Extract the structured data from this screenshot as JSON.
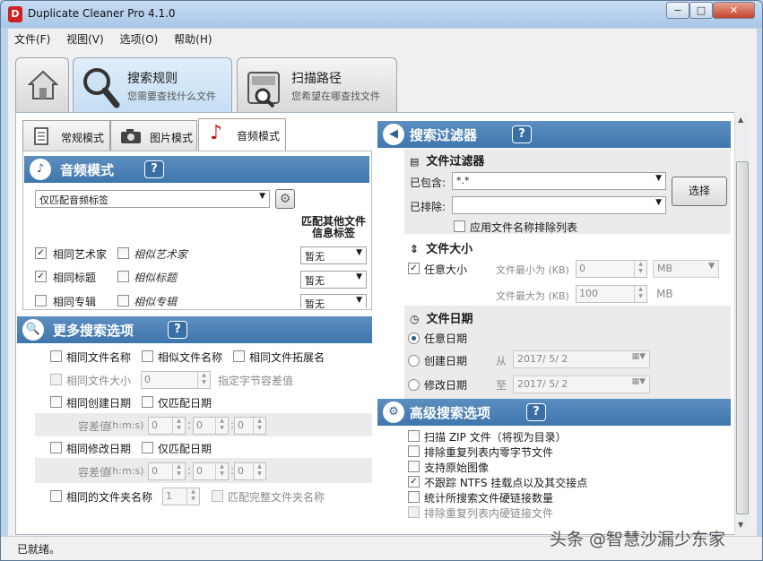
{
  "window": {
    "title": "Duplicate Cleaner Pro 4.1.0",
    "app_icon_letter": "D",
    "min": "−",
    "max": "□",
    "close": "✕"
  },
  "menu": [
    "文件(F)",
    "视图(V)",
    "选项(O)",
    "帮助(H)"
  ],
  "big_tabs": [
    {
      "title": "搜索规则",
      "subtitle": "您需要查找什么文件"
    },
    {
      "title": "扫描路径",
      "subtitle": "您希望在哪查找文件"
    }
  ],
  "mode_tabs": [
    "常规模式",
    "图片模式",
    "音频模式"
  ],
  "audio": {
    "header": "音频模式",
    "help": "?",
    "match_select": "仅匹配音频标签",
    "match_other_label": "匹配其他文件信息标签",
    "rows": [
      {
        "checked": true,
        "label": "相同艺术家",
        "similar": "相似艺术家",
        "combo": "暂无"
      },
      {
        "checked": true,
        "label": "相同标题",
        "similar": "相似标题",
        "combo": "暂无"
      },
      {
        "checked": false,
        "label": "相同专辑",
        "similar": "相似专辑",
        "combo": "暂无"
      }
    ]
  },
  "more": {
    "header": "更多搜索选项",
    "help": "?",
    "same_name": "相同文件名称",
    "similar_name": "相似文件名称",
    "same_ext": "相同文件拓展名",
    "same_size": "相同文件大小",
    "size_value": "0",
    "size_hint": "指定字节容差值",
    "same_created": "相同创建日期",
    "only_date1": "仅匹配日期",
    "tolerance": "容差值",
    "hms": "(h:m:s)",
    "time_zero": "0",
    "same_modified": "相同修改日期",
    "only_date2": "仅匹配日期",
    "same_folder": "相同的文件夹名称",
    "folder_value": "1",
    "full_folder": "匹配完整文件夹名称"
  },
  "filter": {
    "header": "搜索过滤器",
    "help": "?",
    "file_filter": "文件过滤器",
    "include_label": "已包含:",
    "include_value": "*.*",
    "exclude_label": "已排除:",
    "exclude_value": "",
    "select_btn": "选择",
    "apply_exclude": "应用文件名称排除列表",
    "size_title": "文件大小",
    "any_size": "任意大小",
    "min_label": "文件最小为 (KB)",
    "min_value": "0",
    "min_unit": "MB",
    "max_label": "文件最大为 (KB)",
    "max_value": "100",
    "max_unit": "MB",
    "date_title": "文件日期",
    "any_date": "任意日期",
    "created_date": "创建日期",
    "from": "从",
    "date1": "2017/  5/  2",
    "modified_date": "修改日期",
    "to": "至",
    "date2": "2017/  5/  2"
  },
  "advanced": {
    "header": "高级搜索选项",
    "help": "?",
    "items": [
      {
        "checked": false,
        "label": "扫描 ZIP 文件（将视为目录）",
        "disabled": false
      },
      {
        "checked": false,
        "label": "排除重复列表内零字节文件",
        "disabled": false
      },
      {
        "checked": false,
        "label": "支持原始图像",
        "disabled": false
      },
      {
        "checked": true,
        "label": "不跟踪 NTFS 挂载点以及其交接点",
        "disabled": false
      },
      {
        "checked": false,
        "label": "统计所搜索文件硬链接数量",
        "disabled": false
      },
      {
        "checked": false,
        "label": "排除重复列表内硬链接文件",
        "disabled": true
      }
    ]
  },
  "status": "已就绪。",
  "watermark": "头条 @智慧沙漏少东家"
}
